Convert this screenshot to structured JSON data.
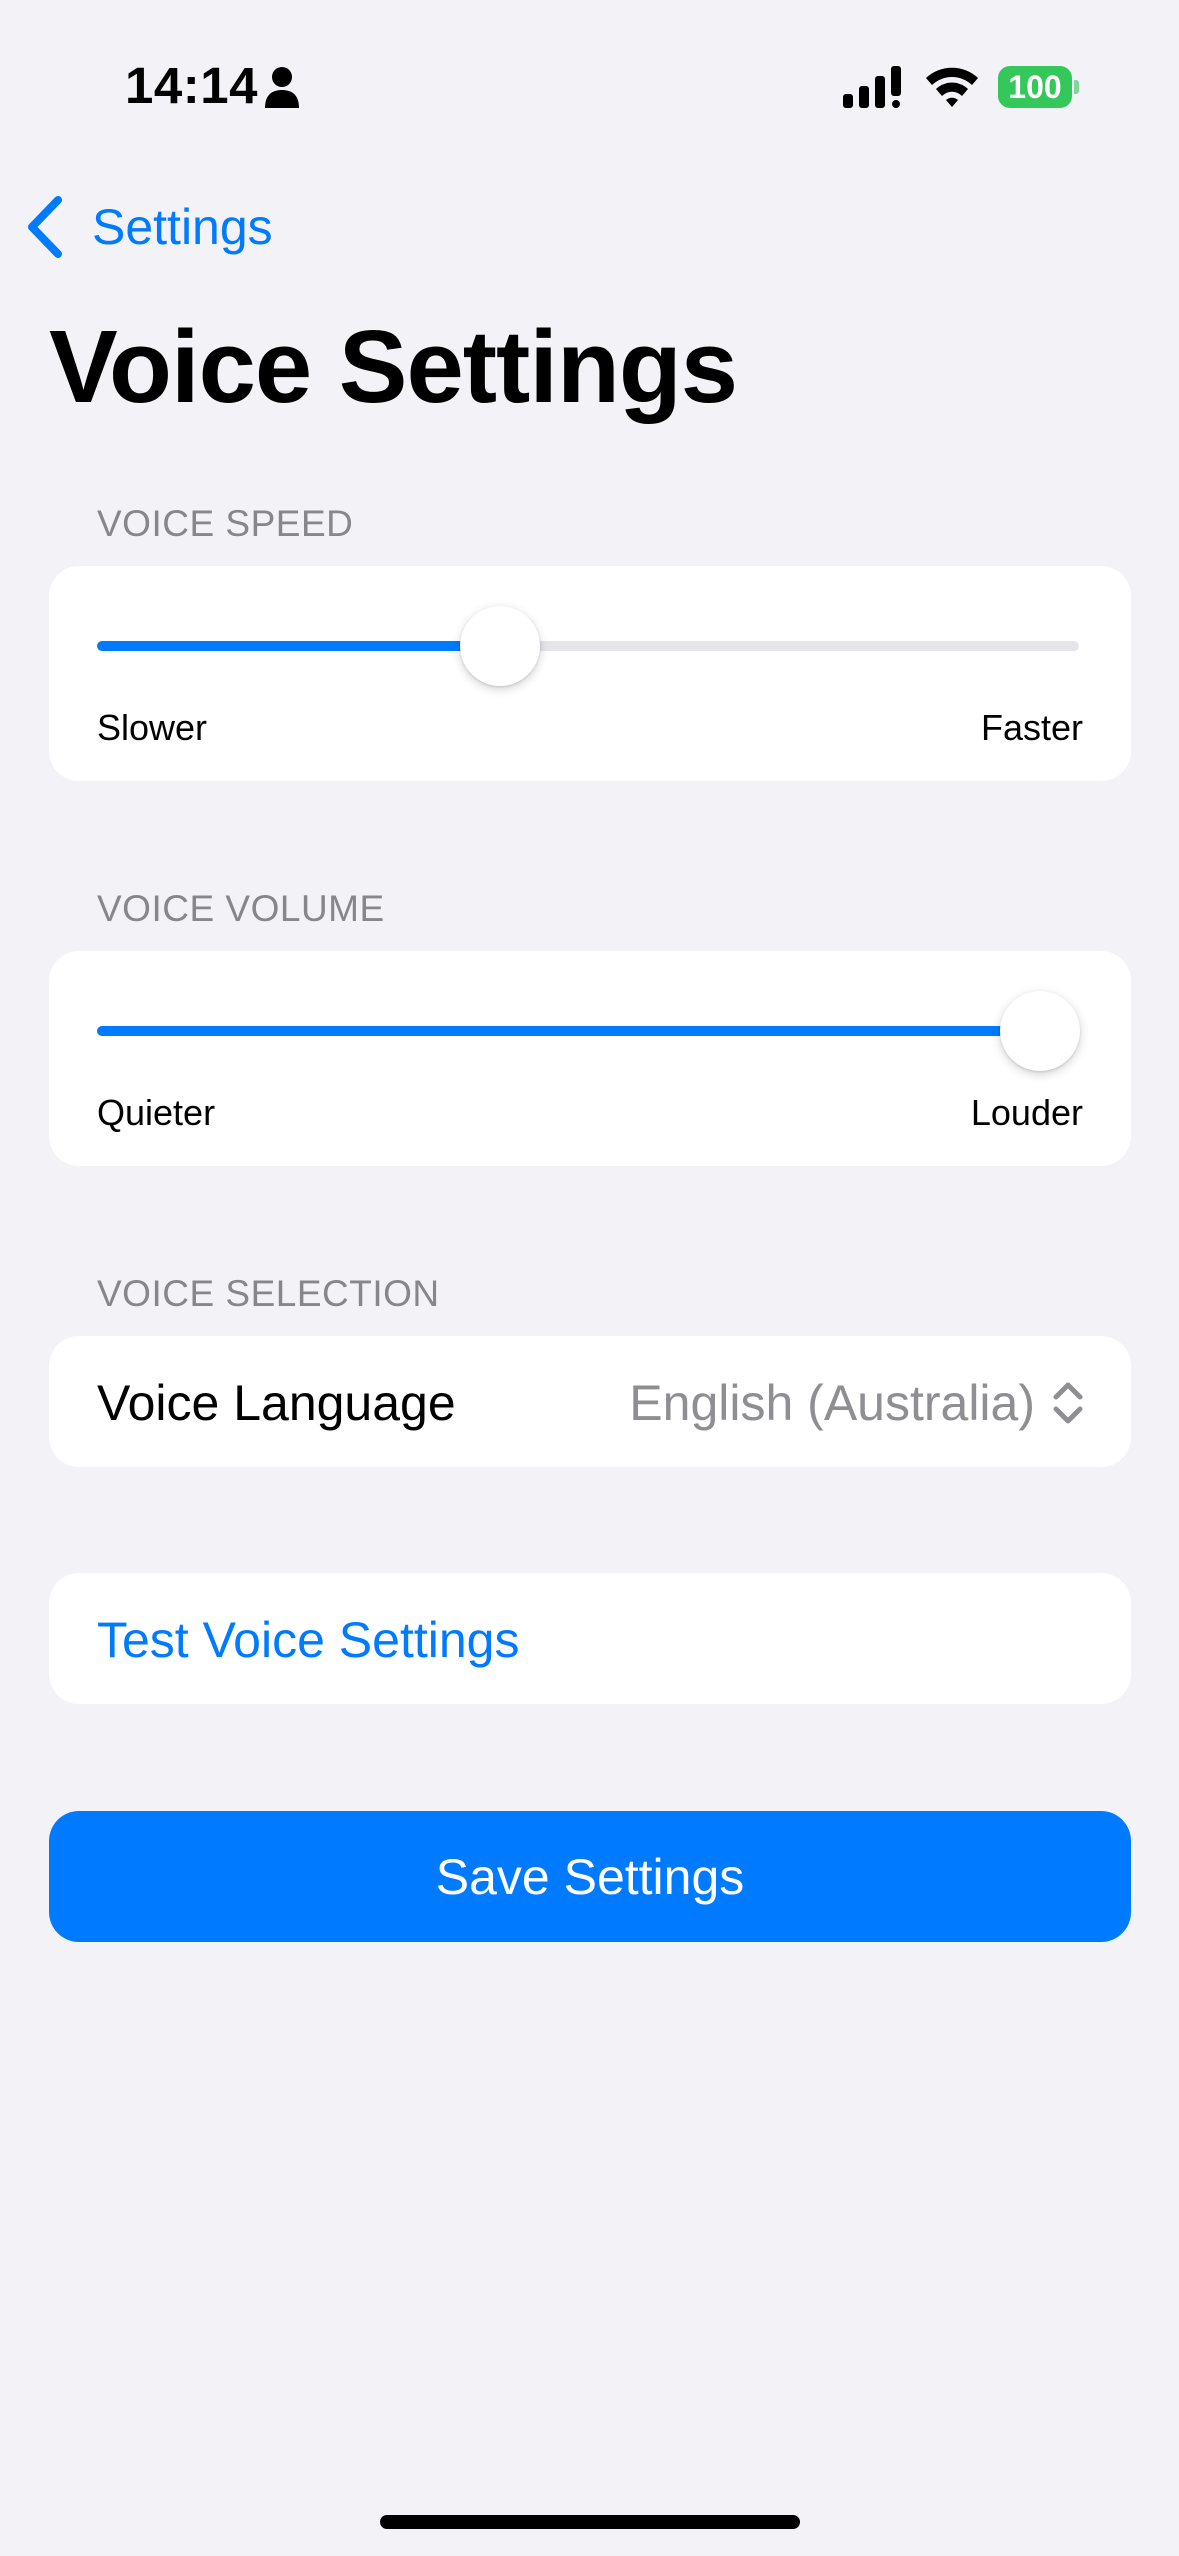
{
  "status_bar": {
    "time": "14:14",
    "battery_level": "100",
    "icons": [
      "person-icon",
      "signal-icon",
      "wifi-icon",
      "battery-icon"
    ]
  },
  "nav": {
    "back_label": "Settings",
    "title": "Voice Settings"
  },
  "voice_speed": {
    "header": "VOICE SPEED",
    "value": 0.41,
    "min_label": "Slower",
    "max_label": "Faster"
  },
  "voice_volume": {
    "header": "VOICE VOLUME",
    "value": 0.96,
    "min_label": "Quieter",
    "max_label": "Louder"
  },
  "voice_selection": {
    "header": "VOICE SELECTION",
    "label": "Voice Language",
    "value": "English (Australia)"
  },
  "test_button": {
    "label": "Test Voice Settings"
  },
  "save_button": {
    "label": "Save Settings"
  },
  "colors": {
    "accent": "#007aff",
    "background": "#f2f2f7",
    "battery": "#34c759"
  }
}
